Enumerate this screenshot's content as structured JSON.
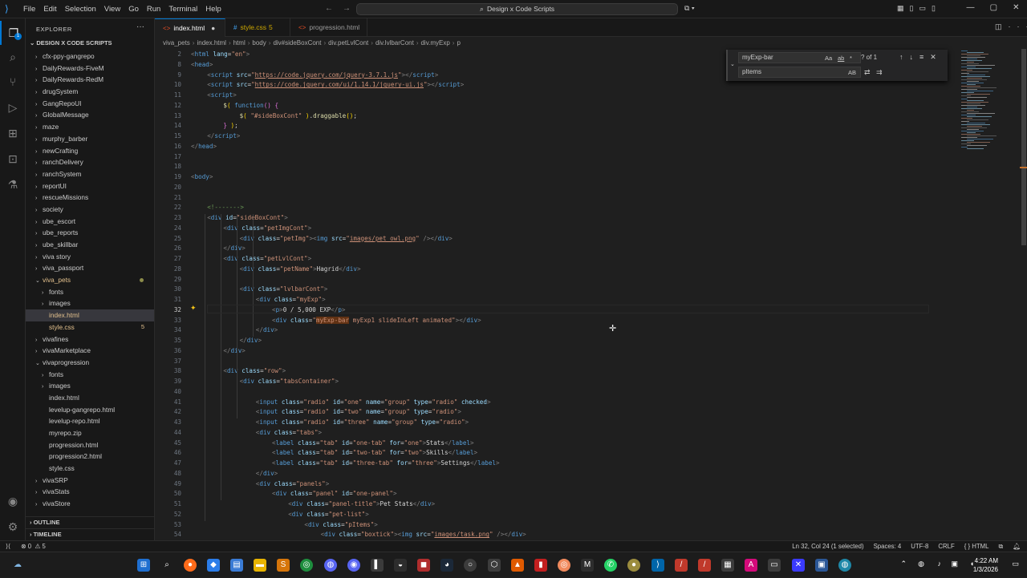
{
  "titlebar": {
    "menus": [
      "File",
      "Edit",
      "Selection",
      "View",
      "Go",
      "Run",
      "Terminal",
      "Help"
    ],
    "search_text": "Design x Code Scripts"
  },
  "activity": {
    "badge": "1"
  },
  "explorer": {
    "header": "EXPLORER",
    "root": "DESIGN X CODE SCRIPTS",
    "items": [
      {
        "name": "cfx-ppy-gangrepo",
        "depth": 1,
        "folder": true,
        "open": false
      },
      {
        "name": "DailyRewards-FiveM",
        "depth": 1,
        "folder": true,
        "open": false
      },
      {
        "name": "DailyRewards-RedM",
        "depth": 1,
        "folder": true,
        "open": false
      },
      {
        "name": "drugSystem",
        "depth": 1,
        "folder": true,
        "open": false
      },
      {
        "name": "GangRepoUI",
        "depth": 1,
        "folder": true,
        "open": false
      },
      {
        "name": "GlobalMessage",
        "depth": 1,
        "folder": true,
        "open": false
      },
      {
        "name": "maze",
        "depth": 1,
        "folder": true,
        "open": false
      },
      {
        "name": "murphy_barber",
        "depth": 1,
        "folder": true,
        "open": false
      },
      {
        "name": "newCrafting",
        "depth": 1,
        "folder": true,
        "open": false
      },
      {
        "name": "ranchDelivery",
        "depth": 1,
        "folder": true,
        "open": false
      },
      {
        "name": "ranchSystem",
        "depth": 1,
        "folder": true,
        "open": false
      },
      {
        "name": "reportUI",
        "depth": 1,
        "folder": true,
        "open": false
      },
      {
        "name": "rescueMissions",
        "depth": 1,
        "folder": true,
        "open": false
      },
      {
        "name": "society",
        "depth": 1,
        "folder": true,
        "open": false
      },
      {
        "name": "ube_escort",
        "depth": 1,
        "folder": true,
        "open": false
      },
      {
        "name": "ube_reports",
        "depth": 1,
        "folder": true,
        "open": false
      },
      {
        "name": "ube_skillbar",
        "depth": 1,
        "folder": true,
        "open": false
      },
      {
        "name": "viva story",
        "depth": 1,
        "folder": true,
        "open": false
      },
      {
        "name": "viva_passport",
        "depth": 1,
        "folder": true,
        "open": false
      },
      {
        "name": "viva_pets",
        "depth": 1,
        "folder": true,
        "open": true,
        "color": "#e2c08d",
        "dot": true
      },
      {
        "name": "fonts",
        "depth": 2,
        "folder": true,
        "open": false
      },
      {
        "name": "images",
        "depth": 2,
        "folder": true,
        "open": false
      },
      {
        "name": "index.html",
        "depth": 2,
        "folder": false,
        "selected": true,
        "color": "#e2c08d"
      },
      {
        "name": "style.css",
        "depth": 2,
        "folder": false,
        "color": "#e2c08d",
        "count": "5"
      },
      {
        "name": "vivafines",
        "depth": 1,
        "folder": true,
        "open": false
      },
      {
        "name": "vivaMarketplace",
        "depth": 1,
        "folder": true,
        "open": false
      },
      {
        "name": "vivaprogression",
        "depth": 1,
        "folder": true,
        "open": true
      },
      {
        "name": "fonts",
        "depth": 2,
        "folder": true,
        "open": false
      },
      {
        "name": "images",
        "depth": 2,
        "folder": true,
        "open": false
      },
      {
        "name": "index.html",
        "depth": 2,
        "folder": false
      },
      {
        "name": "levelup-gangrepo.html",
        "depth": 2,
        "folder": false
      },
      {
        "name": "levelup-repo.html",
        "depth": 2,
        "folder": false
      },
      {
        "name": "myrepo.zip",
        "depth": 2,
        "folder": false
      },
      {
        "name": "progression.html",
        "depth": 2,
        "folder": false
      },
      {
        "name": "progression2.html",
        "depth": 2,
        "folder": false
      },
      {
        "name": "style.css",
        "depth": 2,
        "folder": false
      },
      {
        "name": "vivaSRP",
        "depth": 1,
        "folder": true,
        "open": false
      },
      {
        "name": "vivaStats",
        "depth": 1,
        "folder": true,
        "open": false
      },
      {
        "name": "vivaStore",
        "depth": 1,
        "folder": true,
        "open": false
      }
    ],
    "outline": "OUTLINE",
    "timeline": "TIMELINE"
  },
  "tabs": [
    {
      "label": "index.html",
      "active": true,
      "modified": true,
      "icon_color": "#e44d26"
    },
    {
      "label": "style.css",
      "count": "5",
      "icon_color": "#42a5f5",
      "label_color": "#cca700"
    },
    {
      "label": "progression.html",
      "icon_color": "#e44d26"
    }
  ],
  "breadcrumb": [
    "viva_pets",
    "index.html",
    "html",
    "body",
    "div#sideBoxCont",
    "div.petLvlCont",
    "div.lvlbarCont",
    "div.myExp",
    "p"
  ],
  "find": {
    "query": "myExp-bar",
    "replace": "pItems",
    "count": "? of 1",
    "opts": [
      "Aa",
      "ab",
      "*"
    ]
  },
  "code_lines": [
    {
      "n": "2",
      "h": "<span class='br'>&lt;</span><span class='tg'>html</span> <span class='at'>lang</span><span class='pl'>=</span><span class='st'>\"en\"</span><span class='br'>&gt;</span>",
      "i": 0
    },
    {
      "n": "8",
      "h": "<span class='br'>&lt;</span><span class='tg'>head</span><span class='br'>&gt;</span>",
      "i": 0
    },
    {
      "n": "9",
      "h": "<span class='br'>&lt;</span><span class='tg'>script</span> <span class='at'>src</span><span class='pl'>=</span><span class='st'>\"<span class='ul'>https://code.jquery.com/jquery-3.7.1.js</span>\"</span><span class='br'>&gt;&lt;/</span><span class='tg'>script</span><span class='br'>&gt;</span>",
      "i": 4
    },
    {
      "n": "10",
      "h": "<span class='br'>&lt;</span><span class='tg'>script</span> <span class='at'>src</span><span class='pl'>=</span><span class='st'>\"<span class='ul'>https://code.jquery.com/ui/1.14.1/jquery-ui.js</span>\"</span><span class='br'>&gt;&lt;/</span><span class='tg'>script</span><span class='br'>&gt;</span>",
      "i": 4
    },
    {
      "n": "11",
      "h": "<span class='br'>&lt;</span><span class='tg'>script</span><span class='br'>&gt;</span>",
      "i": 4
    },
    {
      "n": "12",
      "h": "<span class='fn'>$</span><span class='yb'>(</span> <span class='tg'>function</span><span class='pb'>()</span> <span class='pb'>{</span>",
      "i": 8
    },
    {
      "n": "13",
      "h": "<span class='fn'>$</span><span class='yb'>(</span> <span class='st'>\"#sideBoxCont\"</span> <span class='yb'>)</span><span class='pl'>.</span><span class='fn'>draggable</span><span class='yb'>()</span><span class='pl'>;</span>",
      "i": 12
    },
    {
      "n": "14",
      "h": "<span class='pb'>}</span> <span class='yb'>)</span><span class='pl'>;</span>",
      "i": 8
    },
    {
      "n": "15",
      "h": "<span class='br'>&lt;/</span><span class='tg'>script</span><span class='br'>&gt;</span>",
      "i": 4
    },
    {
      "n": "16",
      "h": "<span class='br'>&lt;/</span><span class='tg'>head</span><span class='br'>&gt;</span>",
      "i": 0
    },
    {
      "n": "17",
      "h": "",
      "i": 0
    },
    {
      "n": "18",
      "h": "",
      "i": 0
    },
    {
      "n": "19",
      "h": "<span class='br'>&lt;</span><span class='tg'>body</span><span class='br'>&gt;</span>",
      "i": 0
    },
    {
      "n": "20",
      "h": "",
      "i": 0
    },
    {
      "n": "21",
      "h": "",
      "i": 0
    },
    {
      "n": "22",
      "h": "<span class='cm'>&lt;!-------&gt;</span>",
      "i": 4
    },
    {
      "n": "23",
      "h": "<span class='br'>&lt;</span><span class='tg'>div</span> <span class='at'>id</span><span class='pl'>=</span><span class='st'>\"sideBoxCont\"</span><span class='br'>&gt;</span>",
      "i": 4
    },
    {
      "n": "24",
      "h": "<span class='br'>&lt;</span><span class='tg'>div</span> <span class='at'>class</span><span class='pl'>=</span><span class='st'>\"petImgCont\"</span><span class='br'>&gt;</span>",
      "i": 8
    },
    {
      "n": "25",
      "h": "<span class='br'>&lt;</span><span class='tg'>div</span> <span class='at'>class</span><span class='pl'>=</span><span class='st'>\"petImg\"</span><span class='br'>&gt;&lt;</span><span class='tg'>img</span> <span class='at'>src</span><span class='pl'>=</span><span class='st'>\"<span class='ul'>images/pet_owl.png</span>\"</span> <span class='br'>/&gt;&lt;/</span><span class='tg'>div</span><span class='br'>&gt;</span>",
      "i": 12
    },
    {
      "n": "26",
      "h": "<span class='br'>&lt;/</span><span class='tg'>div</span><span class='br'>&gt;</span>",
      "i": 8
    },
    {
      "n": "27",
      "h": "<span class='br'>&lt;</span><span class='tg'>div</span> <span class='at'>class</span><span class='pl'>=</span><span class='st'>\"petLvlCont\"</span><span class='br'>&gt;</span>",
      "i": 8
    },
    {
      "n": "28",
      "h": "<span class='br'>&lt;</span><span class='tg'>div</span> <span class='at'>class</span><span class='pl'>=</span><span class='st'>\"petName\"</span><span class='br'>&gt;</span><span class='pl'>Hagrid</span><span class='br'>&lt;/</span><span class='tg'>div</span><span class='br'>&gt;</span>",
      "i": 12
    },
    {
      "n": "29",
      "h": "",
      "i": 0
    },
    {
      "n": "30",
      "h": "<span class='br'>&lt;</span><span class='tg'>div</span> <span class='at'>class</span><span class='pl'>=</span><span class='st'>\"lvlbarCont\"</span><span class='br'>&gt;</span>",
      "i": 12
    },
    {
      "n": "31",
      "h": "<span class='br'>&lt;</span><span class='tg'>div</span> <span class='at'>class</span><span class='pl'>=</span><span class='st'>\"myExp\"</span><span class='br'>&gt;</span>",
      "i": 16
    },
    {
      "n": "32",
      "h": "<span class='br'>&lt;</span><span class='tg'>p</span><span class='br'>&gt;</span><span class='pl'>0 / 5,000 EXP</span><span class='br'>&lt;/</span><span class='tg'>p</span><span class='br'>&gt;</span>",
      "i": 20,
      "cur": true
    },
    {
      "n": "33",
      "h": "<span class='br'>&lt;</span><span class='tg'>div</span> <span class='at'>class</span><span class='pl'>=</span><span class='st'>\"<span class='hl'>myExp-bar</span> myExp1 slideInLeft animated\"</span><span class='br'>&gt;&lt;/</span><span class='tg'>div</span><span class='br'>&gt;</span>",
      "i": 20
    },
    {
      "n": "34",
      "h": "<span class='br'>&lt;/</span><span class='tg'>div</span><span class='br'>&gt;</span>",
      "i": 16
    },
    {
      "n": "35",
      "h": "<span class='br'>&lt;/</span><span class='tg'>div</span><span class='br'>&gt;</span>",
      "i": 12
    },
    {
      "n": "36",
      "h": "<span class='br'>&lt;/</span><span class='tg'>div</span><span class='br'>&gt;</span>",
      "i": 8
    },
    {
      "n": "37",
      "h": "",
      "i": 0
    },
    {
      "n": "38",
      "h": "<span class='br'>&lt;</span><span class='tg'>div</span> <span class='at'>class</span><span class='pl'>=</span><span class='st'>\"row\"</span><span class='br'>&gt;</span>",
      "i": 8
    },
    {
      "n": "39",
      "h": "<span class='br'>&lt;</span><span class='tg'>div</span> <span class='at'>class</span><span class='pl'>=</span><span class='st'>\"tabsContainer\"</span><span class='br'>&gt;</span>",
      "i": 12
    },
    {
      "n": "40",
      "h": "",
      "i": 0
    },
    {
      "n": "41",
      "h": "<span class='br'>&lt;</span><span class='tg'>input</span> <span class='at'>class</span><span class='pl'>=</span><span class='st'>\"radio\"</span> <span class='at'>id</span><span class='pl'>=</span><span class='st'>\"one\"</span> <span class='at'>name</span><span class='pl'>=</span><span class='st'>\"group\"</span> <span class='at'>type</span><span class='pl'>=</span><span class='st'>\"radio\"</span> <span class='at'>checked</span><span class='br'>&gt;</span>",
      "i": 16
    },
    {
      "n": "42",
      "h": "<span class='br'>&lt;</span><span class='tg'>input</span> <span class='at'>class</span><span class='pl'>=</span><span class='st'>\"radio\"</span> <span class='at'>id</span><span class='pl'>=</span><span class='st'>\"two\"</span> <span class='at'>name</span><span class='pl'>=</span><span class='st'>\"group\"</span> <span class='at'>type</span><span class='pl'>=</span><span class='st'>\"radio\"</span><span class='br'>&gt;</span>",
      "i": 16
    },
    {
      "n": "43",
      "h": "<span class='br'>&lt;</span><span class='tg'>input</span> <span class='at'>class</span><span class='pl'>=</span><span class='st'>\"radio\"</span> <span class='at'>id</span><span class='pl'>=</span><span class='st'>\"three\"</span> <span class='at'>name</span><span class='pl'>=</span><span class='st'>\"group\"</span> <span class='at'>type</span><span class='pl'>=</span><span class='st'>\"radio\"</span><span class='br'>&gt;</span>",
      "i": 16
    },
    {
      "n": "44",
      "h": "<span class='br'>&lt;</span><span class='tg'>div</span> <span class='at'>class</span><span class='pl'>=</span><span class='st'>\"tabs\"</span><span class='br'>&gt;</span>",
      "i": 16
    },
    {
      "n": "45",
      "h": "<span class='br'>&lt;</span><span class='tg'>label</span> <span class='at'>class</span><span class='pl'>=</span><span class='st'>\"tab\"</span> <span class='at'>id</span><span class='pl'>=</span><span class='st'>\"one-tab\"</span> <span class='at'>for</span><span class='pl'>=</span><span class='st'>\"one\"</span><span class='br'>&gt;</span><span class='pl'>Stats</span><span class='br'>&lt;/</span><span class='tg'>label</span><span class='br'>&gt;</span>",
      "i": 20
    },
    {
      "n": "46",
      "h": "<span class='br'>&lt;</span><span class='tg'>label</span> <span class='at'>class</span><span class='pl'>=</span><span class='st'>\"tab\"</span> <span class='at'>id</span><span class='pl'>=</span><span class='st'>\"two-tab\"</span> <span class='at'>for</span><span class='pl'>=</span><span class='st'>\"two\"</span><span class='br'>&gt;</span><span class='pl'>Skills</span><span class='br'>&lt;/</span><span class='tg'>label</span><span class='br'>&gt;</span>",
      "i": 20
    },
    {
      "n": "47",
      "h": "<span class='br'>&lt;</span><span class='tg'>label</span> <span class='at'>class</span><span class='pl'>=</span><span class='st'>\"tab\"</span> <span class='at'>id</span><span class='pl'>=</span><span class='st'>\"three-tab\"</span> <span class='at'>for</span><span class='pl'>=</span><span class='st'>\"three\"</span><span class='br'>&gt;</span><span class='pl'>Settings</span><span class='br'>&lt;/</span><span class='tg'>label</span><span class='br'>&gt;</span>",
      "i": 20
    },
    {
      "n": "48",
      "h": "<span class='br'>&lt;/</span><span class='tg'>div</span><span class='br'>&gt;</span>",
      "i": 16
    },
    {
      "n": "49",
      "h": "<span class='br'>&lt;</span><span class='tg'>div</span> <span class='at'>class</span><span class='pl'>=</span><span class='st'>\"panels\"</span><span class='br'>&gt;</span>",
      "i": 16
    },
    {
      "n": "50",
      "h": "<span class='br'>&lt;</span><span class='tg'>div</span> <span class='at'>class</span><span class='pl'>=</span><span class='st'>\"panel\"</span> <span class='at'>id</span><span class='pl'>=</span><span class='st'>\"one-panel\"</span><span class='br'>&gt;</span>",
      "i": 20
    },
    {
      "n": "51",
      "h": "<span class='br'>&lt;</span><span class='tg'>div</span> <span class='at'>class</span><span class='pl'>=</span><span class='st'>\"panel-title\"</span><span class='br'>&gt;</span><span class='pl'>Pet Stats</span><span class='br'>&lt;/</span><span class='tg'>div</span><span class='br'>&gt;</span>",
      "i": 24
    },
    {
      "n": "52",
      "h": "<span class='br'>&lt;</span><span class='tg'>div</span> <span class='at'>class</span><span class='pl'>=</span><span class='st'>\"pet-list\"</span><span class='br'>&gt;</span>",
      "i": 24
    },
    {
      "n": "53",
      "h": "<span class='br'>&lt;</span><span class='tg'>div</span> <span class='at'>class</span><span class='pl'>=</span><span class='st'>\"pItems\"</span><span class='br'>&gt;</span>",
      "i": 28
    },
    {
      "n": "54",
      "h": "<span class='br'>&lt;</span><span class='tg'>div</span> <span class='at'>class</span><span class='pl'>=</span><span class='st'>\"boxtick\"</span><span class='br'>&gt;&lt;</span><span class='tg'>img</span> <span class='at'>src</span><span class='pl'>=</span><span class='st'>\"<span class='ul'>images/task.png</span>\"</span> <span class='br'>/&gt;&lt;/</span><span class='tg'>div</span><span class='br'>&gt;</span>",
      "i": 32
    }
  ],
  "status": {
    "errors": "⊗ 0",
    "warnings": "⚠ 5",
    "position": "Ln 32, Col 24 (1 selected)",
    "spaces": "Spaces: 4",
    "encoding": "UTF-8",
    "eol": "CRLF",
    "language": "HTML"
  },
  "clock": {
    "time": "4:22 AM",
    "date": "1/3/2026"
  }
}
